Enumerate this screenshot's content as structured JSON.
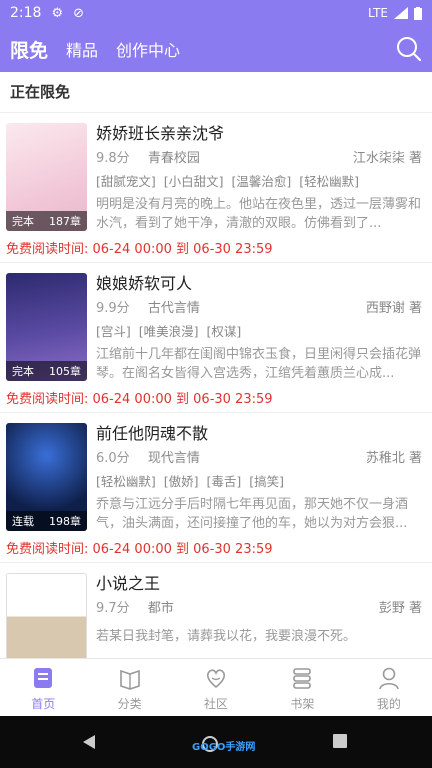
{
  "status_bar": {
    "time": "2:18",
    "network": "LTE"
  },
  "header": {
    "tabs": [
      "限免",
      "精品",
      "创作中心"
    ]
  },
  "section": {
    "title": "正在限免"
  },
  "books": [
    {
      "title": "娇娇班长亲亲沈爷",
      "score": "9.8分",
      "category": "青春校园",
      "author": "江水柒柒 著",
      "tags": [
        "[甜腻宠文]",
        "[小白甜文]",
        "[温馨治愈]",
        "[轻松幽默]"
      ],
      "desc": "明明是没有月亮的晚上。他站在夜色里，透过一层薄雾和水汽，看到了她干净，清澈的双眼。仿佛看到了...",
      "status": "完本",
      "chapters": "187章",
      "free_time": "免费阅读时间: 06-24 00:00 到 06-30 23:59",
      "cover_color": "#f6dbe6"
    },
    {
      "title": "娘娘娇软可人",
      "score": "9.9分",
      "category": "古代言情",
      "author": "西野谢 著",
      "tags": [
        "[宫斗]",
        "[唯美浪漫]",
        "[权谋]"
      ],
      "desc": "江绾前十几年都在闺阁中锦衣玉食，日里闲得只会插花弹琴。在阁名女皆得入宫选秀，江绾凭着蕙质兰心成...",
      "status": "完本",
      "chapters": "105章",
      "free_time": "免费阅读时间: 06-24 00:00 到 06-30 23:59",
      "cover_color": "#4b3c8a"
    },
    {
      "title": "前任他阴魂不散",
      "score": "6.0分",
      "category": "现代言情",
      "author": "苏稚北 著",
      "tags": [
        "[轻松幽默]",
        "[傲娇]",
        "[毒舌]",
        "[搞笑]"
      ],
      "desc": "乔意与江远分手后时隔七年再见面，那天她不仅一身酒气，油头满面，还问接撞了他的车，她以为对方会狠...",
      "status": "连载",
      "chapters": "198章",
      "free_time": "免费阅读时间: 06-24 00:00 到 06-30 23:59",
      "cover_color": "#0f1f4a"
    },
    {
      "title": "小说之王",
      "score": "9.7分",
      "category": "都市",
      "author": "彭野 著",
      "tags": [],
      "desc": "若某日我封笔，请葬我以花，我要浪漫不死。",
      "status": "",
      "chapters": "",
      "free_time": "",
      "cover_color": "#ffffff"
    }
  ],
  "tabbar": {
    "items": [
      "首页",
      "分类",
      "社区",
      "书架",
      "我的"
    ]
  },
  "watermark": "GOGO手游网"
}
